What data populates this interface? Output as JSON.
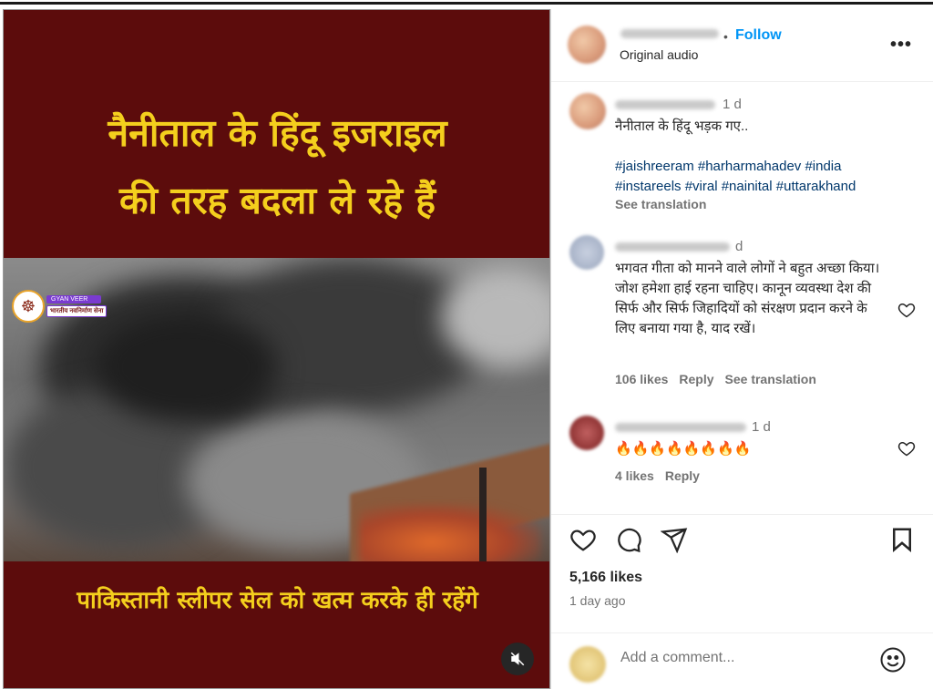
{
  "media": {
    "headline_line1": "नैनीताल के हिंदू इजराइल",
    "headline_line2": "की तरह बदला ले रहे हैं",
    "bottom_text": "पाकिस्तानी स्लीपर सेल को खत्म करके ही रहेंगे",
    "logo_tag1": "GYAN VEER",
    "logo_tag2": "भारतीय नवनिर्माण सेना",
    "mute_icon": "speaker-muted-icon"
  },
  "header": {
    "dot": "•",
    "follow_label": "Follow",
    "audio_label": "Original audio",
    "more_label": "•••"
  },
  "caption": {
    "time": "1 d",
    "text": "नैनीताल के हिंदू भड़क गए..",
    "hashtags_line1": "#jaishreeram #harharmahadev #india",
    "hashtags_line2": "#instareels #viral #nainital #uttarakhand",
    "see_translation": "See translation"
  },
  "comments": [
    {
      "time": "d",
      "text": "भगवत गीता को मानने वाले लोगों ने बहुत अच्छा किया। जोश हमेशा हाई रहना चाहिए। कानून व्यवस्था देश की सिर्फ और सिर्फ जिहादियों को संरक्षण प्रदान करने के लिए बनाया गया है, याद रखें।",
      "likes": "106 likes",
      "reply": "Reply",
      "see_translation": "See translation"
    },
    {
      "time": "1 d",
      "text": "🔥🔥🔥🔥🔥🔥🔥🔥",
      "likes": "4 likes",
      "reply": "Reply"
    }
  ],
  "post": {
    "likes": "5,166 likes",
    "date": "1 day ago"
  },
  "add_comment": {
    "placeholder": "Add a comment..."
  },
  "colors": {
    "brand_blue": "#0095f6",
    "banner_red": "#5c0c0c",
    "headline_yellow": "#f4cf1d"
  }
}
